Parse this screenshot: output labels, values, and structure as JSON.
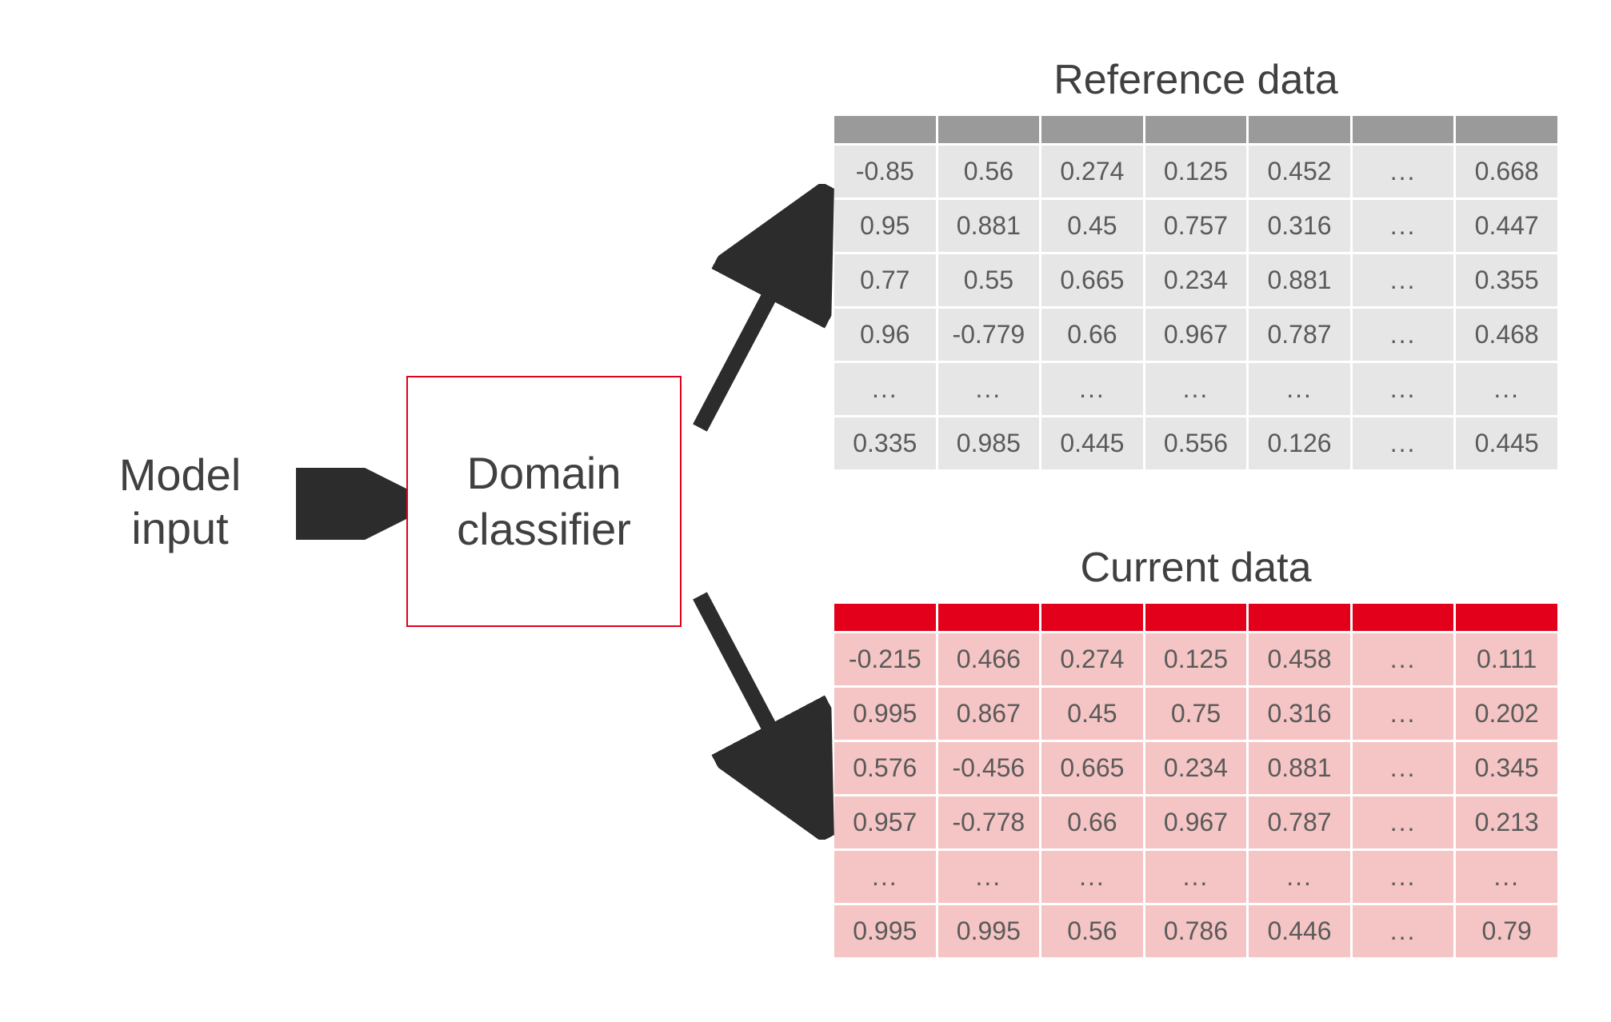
{
  "labels": {
    "model_input": "Model\ninput",
    "classifier": "Domain\nclassifier",
    "reference_title": "Reference data",
    "current_title": "Current data"
  },
  "input_bar_segments": 7,
  "reference_table": {
    "columns": 7,
    "rows": [
      [
        "-0.85",
        "0.56",
        "0.274",
        "0.125",
        "0.452",
        "...",
        "0.668"
      ],
      [
        "0.95",
        "0.881",
        "0.45",
        "0.757",
        "0.316",
        "...",
        "0.447"
      ],
      [
        "0.77",
        "0.55",
        "0.665",
        "0.234",
        "0.881",
        "...",
        "0.355"
      ],
      [
        "0.96",
        "-0.779",
        "0.66",
        "0.967",
        "0.787",
        "...",
        "0.468"
      ],
      [
        "...",
        "...",
        "...",
        "...",
        "...",
        "...",
        "..."
      ],
      [
        "0.335",
        "0.985",
        "0.445",
        "0.556",
        "0.126",
        "...",
        "0.445"
      ]
    ]
  },
  "current_table": {
    "columns": 7,
    "rows": [
      [
        "-0.215",
        "0.466",
        "0.274",
        "0.125",
        "0.458",
        "...",
        "0.111"
      ],
      [
        "0.995",
        "0.867",
        "0.45",
        "0.75",
        "0.316",
        "...",
        "0.202"
      ],
      [
        "0.576",
        "-0.456",
        "0.665",
        "0.234",
        "0.881",
        "...",
        "0.345"
      ],
      [
        "0.957",
        "-0.778",
        "0.66",
        "0.967",
        "0.787",
        "...",
        "0.213"
      ],
      [
        "...",
        "...",
        "...",
        "...",
        "...",
        "...",
        "..."
      ],
      [
        "0.995",
        "0.995",
        "0.56",
        "0.786",
        "0.446",
        "...",
        "0.79"
      ]
    ]
  },
  "colors": {
    "accent_red": "#e2001a",
    "ref_header": "#9a9a9a",
    "ref_cell": "#e6e6e6",
    "cur_cell": "#f5c4c4",
    "arrow": "#2c2c2c"
  }
}
